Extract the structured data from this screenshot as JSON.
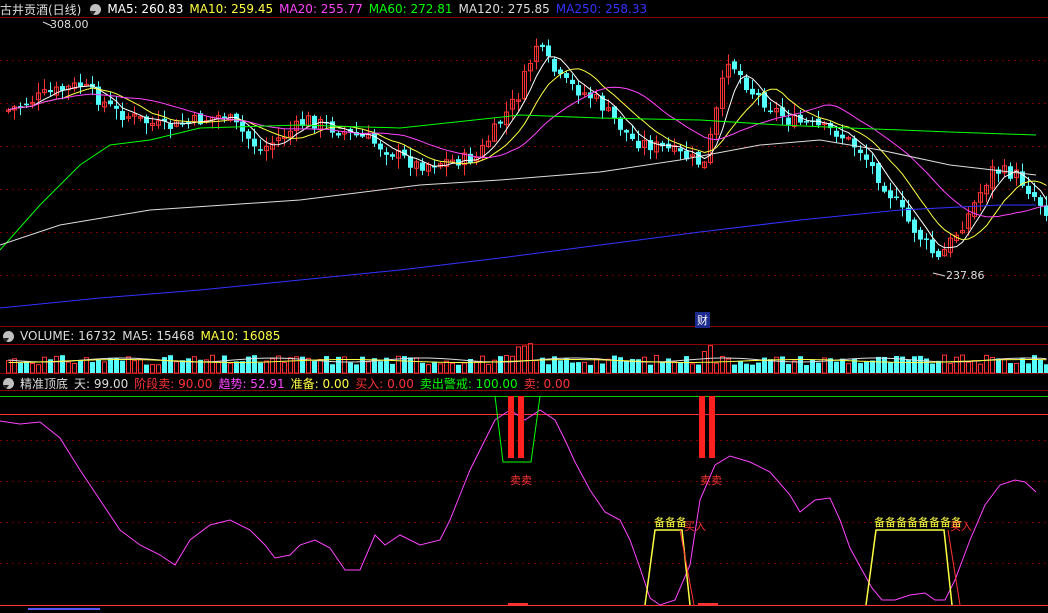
{
  "main_header": {
    "title": "古井贡酒(日线)",
    "ma": [
      {
        "label": "MA5: 260.83",
        "color": "#ffffff"
      },
      {
        "label": "MA10: 259.45",
        "color": "#ffff44"
      },
      {
        "label": "MA20: 255.77",
        "color": "#ff44ff"
      },
      {
        "label": "MA60: 272.81",
        "color": "#00ff00"
      },
      {
        "label": "MA120: 275.85",
        "color": "#dddddd"
      },
      {
        "label": "MA250: 258.33",
        "color": "#3333ff"
      }
    ]
  },
  "annotations": {
    "high_label": "308.00",
    "low_label": "237.86",
    "cai_badge": "财"
  },
  "volume_header": {
    "items": [
      {
        "label": "VOLUME: 16732",
        "color": "#dddddd"
      },
      {
        "label": "MA5: 15468",
        "color": "#dddddd"
      },
      {
        "label": "MA10: 16085",
        "color": "#ffff44"
      }
    ]
  },
  "indicator_header": {
    "items": [
      {
        "label": "精准顶底",
        "color": "#dddddd"
      },
      {
        "label": "天: 99.00",
        "color": "#dddddd"
      },
      {
        "label": "阶段卖: 90.00",
        "color": "#ff3333"
      },
      {
        "label": "趋势: 52.91",
        "color": "#ff44ff"
      },
      {
        "label": "准备: 0.00",
        "color": "#ffff44"
      },
      {
        "label": "买入: 0.00",
        "color": "#ff3333"
      },
      {
        "label": "卖出警戒: 100.00",
        "color": "#00ff00"
      },
      {
        "label": "卖: 0.00",
        "color": "#ff3333"
      }
    ]
  },
  "signals": {
    "sell1": "卖卖",
    "sell2": "卖卖",
    "prep1": "备备备",
    "buy1": "买入",
    "prep2": "备备备备备备备备",
    "buy2": "买入"
  },
  "chart_data": {
    "type": "candlestick",
    "panels": [
      "price",
      "volume",
      "indicator"
    ],
    "price_marks": {
      "high": 308.0,
      "low": 237.86
    },
    "moving_averages": {
      "MA5": 260.83,
      "MA10": 259.45,
      "MA20": 255.77,
      "MA60": 272.81,
      "MA120": 275.85,
      "MA250": 258.33
    },
    "volume": {
      "VOLUME": 16732,
      "MA5": 15468,
      "MA10": 16085
    },
    "indicator": {
      "天": 99.0,
      "阶段卖": 90.0,
      "趋势": 52.91,
      "准备": 0.0,
      "买入": 0.0,
      "卖出警戒": 100.0,
      "卖": 0.0
    },
    "colors": {
      "up": "#ff3333",
      "down": "#54ffff",
      "grid": "#7a0000"
    }
  }
}
